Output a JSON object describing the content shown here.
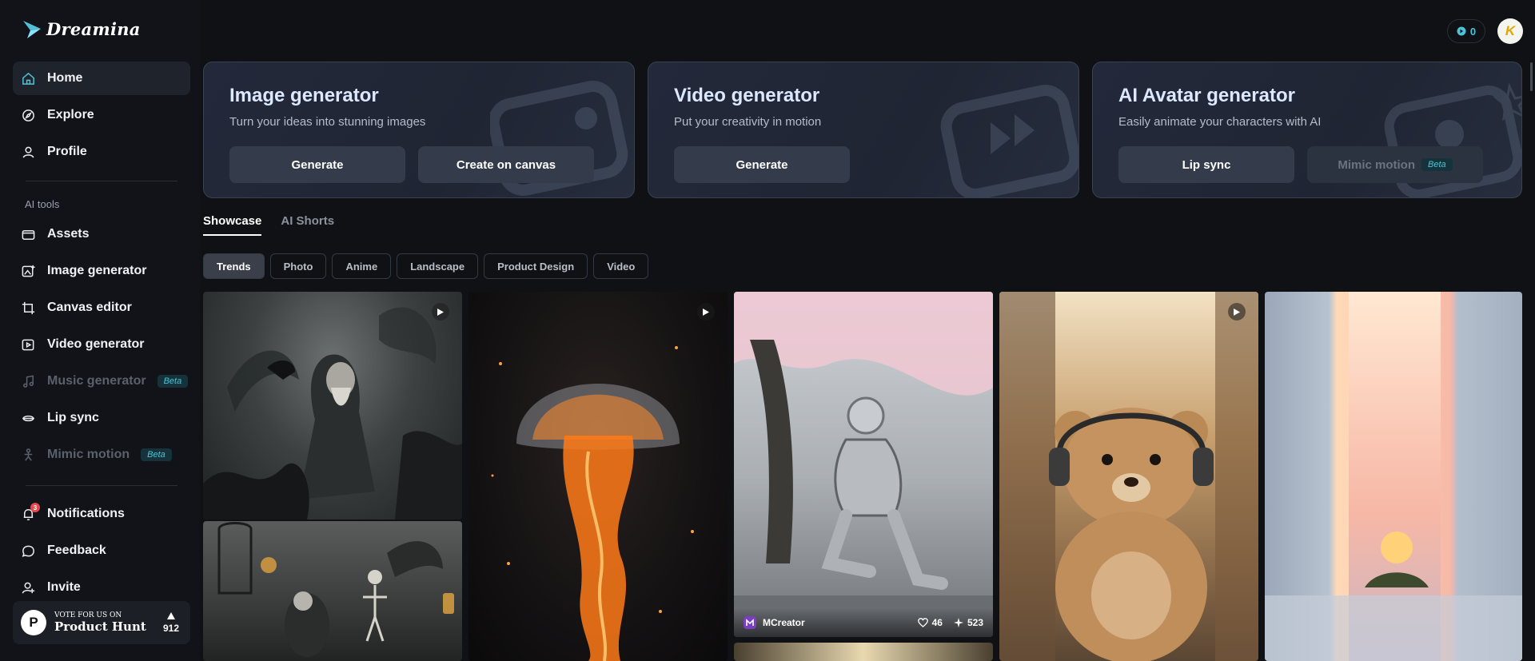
{
  "app": {
    "name": "Dreamina"
  },
  "sidebar": {
    "nav_top": [
      {
        "label": "Home",
        "icon": "home-icon"
      },
      {
        "label": "Explore",
        "icon": "compass-icon"
      },
      {
        "label": "Profile",
        "icon": "user-icon"
      }
    ],
    "section_label": "AI tools",
    "tools": [
      {
        "label": "Assets",
        "icon": "folder-icon"
      },
      {
        "label": "Image generator",
        "icon": "image-plus-icon"
      },
      {
        "label": "Canvas editor",
        "icon": "crop-icon"
      },
      {
        "label": "Video generator",
        "icon": "video-icon"
      },
      {
        "label": "Music generator",
        "icon": "music-icon",
        "badge": "Beta"
      },
      {
        "label": "Lip sync",
        "icon": "lipsync-icon"
      },
      {
        "label": "Mimic motion",
        "icon": "motion-icon",
        "badge": "Beta"
      }
    ],
    "bottom": [
      {
        "label": "Notifications",
        "icon": "bell-icon",
        "count": "3"
      },
      {
        "label": "Feedback",
        "icon": "chat-icon"
      },
      {
        "label": "Invite",
        "icon": "invite-icon"
      }
    ],
    "product_hunt": {
      "logo": "P",
      "small": "VOTE FOR US ON",
      "big": "Product Hunt",
      "votes": "912"
    }
  },
  "header": {
    "credits": "0",
    "avatar_letter": "K"
  },
  "cards": [
    {
      "title": "Image generator",
      "subtitle": "Turn your ideas into stunning images",
      "buttons": [
        "Generate",
        "Create on canvas"
      ]
    },
    {
      "title": "Video generator",
      "subtitle": "Put your creativity in motion",
      "buttons": [
        "Generate"
      ]
    },
    {
      "title": "AI Avatar generator",
      "subtitle": "Easily animate your characters with AI",
      "buttons": [
        "Lip sync",
        "Mimic motion"
      ],
      "beta": "Beta"
    }
  ],
  "tabs": [
    "Showcase",
    "AI Shorts"
  ],
  "filters": [
    "Trends",
    "Photo",
    "Anime",
    "Landscape",
    "Product Design",
    "Video"
  ],
  "gallery": {
    "robot": {
      "author": "MCreator",
      "likes": "46",
      "remixes": "523"
    }
  },
  "colors": {
    "accent": "#4fc3d6",
    "background": "#0f1115",
    "card": "#23293a"
  }
}
